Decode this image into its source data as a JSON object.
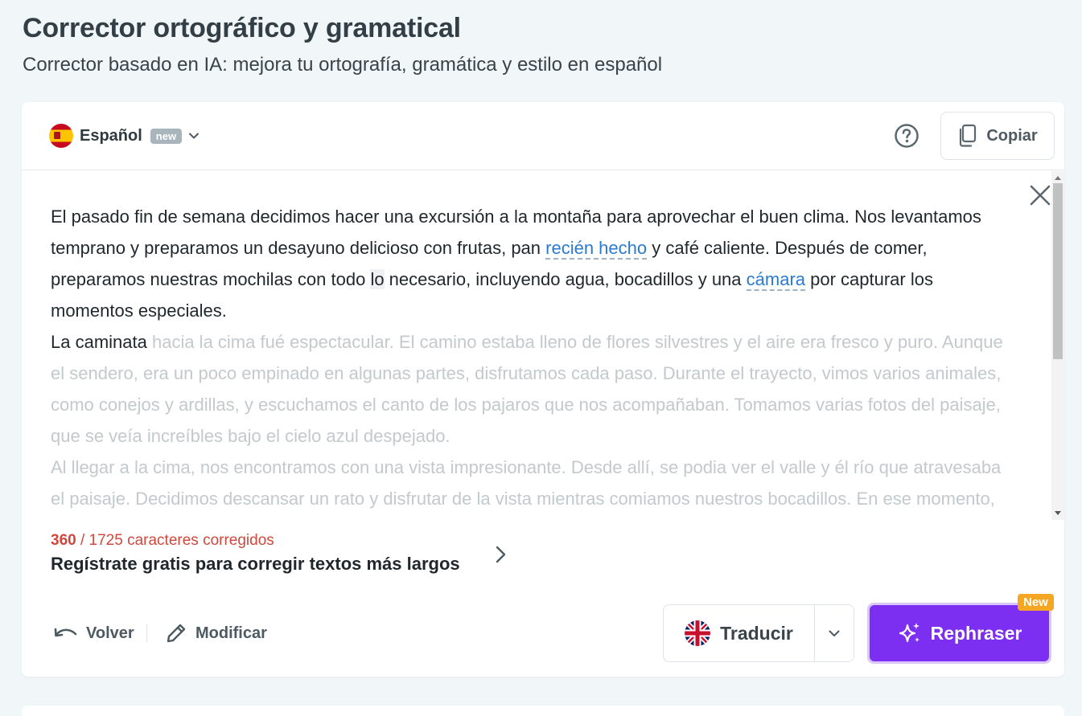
{
  "header": {
    "title": "Corrector ortográfico y gramatical",
    "subtitle": "Corrector basado en IA: mejora tu ortografía, gramática y estilo en español"
  },
  "toolbar": {
    "language": "Español",
    "language_badge": "new",
    "copy_label": "Copiar"
  },
  "editor": {
    "p1_a": "El pasado fin de semana decidimos hacer una excursión a la montaña para aprovechar el buen clima. Nos levantamos temprano y preparamos un desayuno delicioso con frutas, pan ",
    "p1_hl1": "recién hecho",
    "p1_b": " y café caliente. Después de comer, preparamos nuestras mochilas con todo ",
    "p1_sel": "lo",
    "p1_c": " necesario, incluyendo agua, bocadillos y una ",
    "p1_hl2": "cámara",
    "p1_d": " por capturar los momentos especiales.",
    "p2_a": "La caminata",
    "p2_faded": " hacia la cima fué espectacular. El camino estaba lleno de flores silvestres y el aire era fresco y puro. Aunque el sendero, era un poco empinado en algunas partes, disfrutamos cada paso. Durante el trayecto, vimos varios animales, como conejos y ardillas, y escuchamos el canto de los pajaros que nos acompañaban. Tomamos varias fotos del paisaje, que se veía increíbles bajo el cielo azul despejado.",
    "p3_faded": "Al llegar a la cima, nos encontramos con una vista impresionante. Desde allí, se podia ver el valle y él río que atravesaba el paisaje. Decidimos descansar un rato y disfrutar de la vista mientras comiamos nuestros bocadillos. En ese momento, nos sentimos muy conectados con la naturaleza y agradecidos por la oportunidad de estar allí."
  },
  "footer": {
    "chars_corrected": "360",
    "chars_total": " / 1725 caracteres corregidos",
    "signup_text": "Regístrate gratis para corregir textos más largos",
    "back_label": "Volver",
    "edit_label": "Modificar",
    "translate_label": "Traducir",
    "rephraser_label": "Rephraser",
    "rephraser_badge": "New"
  },
  "colors": {
    "accent": "#7c2ff0",
    "highlight": "#2a7bd0",
    "counter": "#d0483c",
    "badge_new": "#f5a623"
  }
}
